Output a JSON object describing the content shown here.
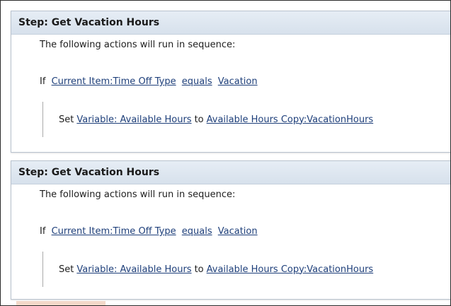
{
  "steps": [
    {
      "title": "Step: Get Vacation Hours",
      "sequence_text": "The following actions will run in sequence:",
      "condition": {
        "keyword": "If",
        "field": "Current Item:Time Off Type",
        "operator": "equals",
        "value": "Vacation"
      },
      "action": {
        "keyword": "Set",
        "target": "Variable: Available Hours",
        "connector": "to",
        "source": "Available Hours Copy:VacationHours"
      }
    },
    {
      "title": "Step: Get Vacation Hours",
      "sequence_text": "The following actions will run in sequence:",
      "condition": {
        "keyword": "If",
        "field": "Current Item:Time Off Type",
        "operator": "equals",
        "value": "Vacation"
      },
      "action": {
        "keyword": "Set",
        "target": "Variable: Available Hours",
        "connector": "to",
        "source": "Available Hours Copy:VacationHours"
      }
    }
  ],
  "colors": {
    "header_bg": "#dde6f0",
    "link": "#1e3f7a",
    "border": "#b9c3cf"
  }
}
